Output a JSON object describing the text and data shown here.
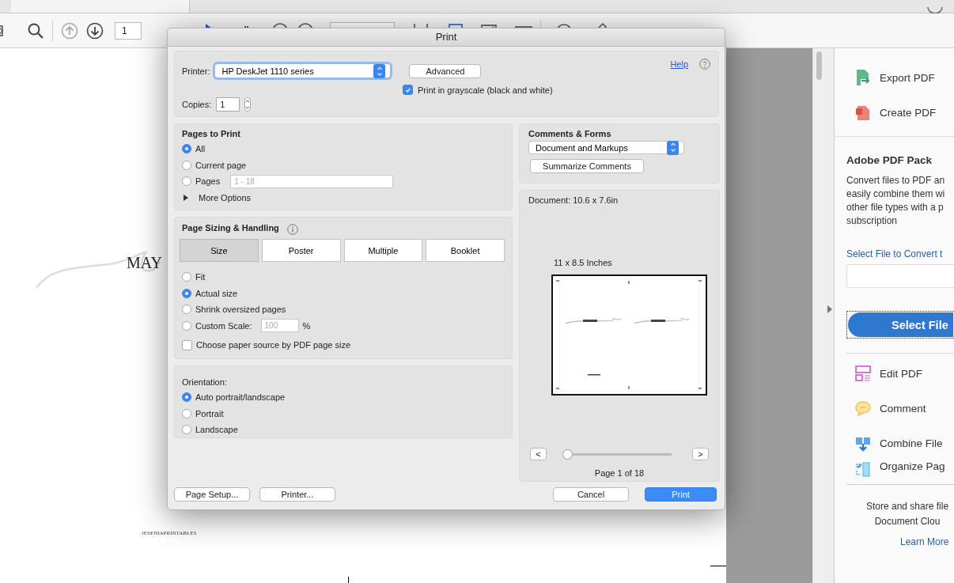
{
  "toolbar": {
    "page_field": "1"
  },
  "document": {
    "heading": "MAY",
    "footer": "JESENIAPRINTABLES"
  },
  "print_dialog": {
    "title": "Print",
    "printer": {
      "label": "Printer:",
      "value": "HP DeskJet 1110 series"
    },
    "advanced_button": "Advanced",
    "help_link": "Help",
    "copies": {
      "label": "Copies:",
      "value": "1"
    },
    "grayscale": {
      "label": "Print in grayscale (black and white)",
      "checked": true
    },
    "pages_to_print": {
      "title": "Pages to Print",
      "options": [
        {
          "label": "All",
          "selected": true
        },
        {
          "label": "Current page",
          "selected": false
        },
        {
          "label": "Pages",
          "selected": false,
          "placeholder": "1 - 18"
        }
      ],
      "more_options": {
        "label": "More Options",
        "expanded": false
      }
    },
    "page_sizing": {
      "title": "Page Sizing & Handling",
      "tabs": [
        {
          "label": "Size",
          "selected": true
        },
        {
          "label": "Poster",
          "selected": false
        },
        {
          "label": "Multiple",
          "selected": false
        },
        {
          "label": "Booklet",
          "selected": false
        }
      ],
      "options": [
        {
          "label": "Fit",
          "selected": false
        },
        {
          "label": "Actual size",
          "selected": true
        },
        {
          "label": "Shrink oversized pages",
          "selected": false
        },
        {
          "label": "Custom Scale:",
          "selected": false,
          "placeholder": "100",
          "unit": "%"
        }
      ],
      "paper_source": {
        "label": "Choose paper source by PDF page size",
        "checked": false
      }
    },
    "orientation": {
      "title": "Orientation:",
      "options": [
        {
          "label": "Auto portrait/landscape",
          "selected": true
        },
        {
          "label": "Portrait",
          "selected": false
        },
        {
          "label": "Landscape",
          "selected": false
        }
      ]
    },
    "comments_forms": {
      "title": "Comments & Forms",
      "value": "Document and Markups",
      "button": "Summarize Comments"
    },
    "preview": {
      "document_size": "Document: 10.6 x 7.6in",
      "paper_size": "11 x 8.5 Inches",
      "prev_button": "<",
      "next_button": ">",
      "slider": {
        "level": 0
      },
      "page_label": "Page 1 of 18"
    },
    "buttons": [
      {
        "label": "Page Setup...",
        "kind": "plain"
      },
      {
        "label": "Printer...",
        "kind": "plain"
      },
      {
        "label": "Cancel",
        "kind": "plain"
      },
      {
        "label": "Print",
        "kind": "default"
      }
    ]
  },
  "right_pane": {
    "top_tools": [
      {
        "label": "Export PDF",
        "kind": "export"
      },
      {
        "label": "Create PDF",
        "kind": "create"
      }
    ],
    "pack_title": "Adobe PDF Pack",
    "pack_description": "Convert files to PDF an\neasily combine them wi\nother file types with a p\nsubscription",
    "convert_link": "Select File to Convert t",
    "select_button": "Select File",
    "tools": [
      {
        "label": "Edit PDF",
        "kind": "edit"
      },
      {
        "label": "Comment",
        "kind": "comment"
      },
      {
        "label": "Combine File",
        "kind": "combine"
      },
      {
        "label": "Organize Pag",
        "kind": "organize"
      }
    ],
    "cloud_text": "Store and share file\nDocument Clou",
    "learn_more": "Learn More"
  }
}
